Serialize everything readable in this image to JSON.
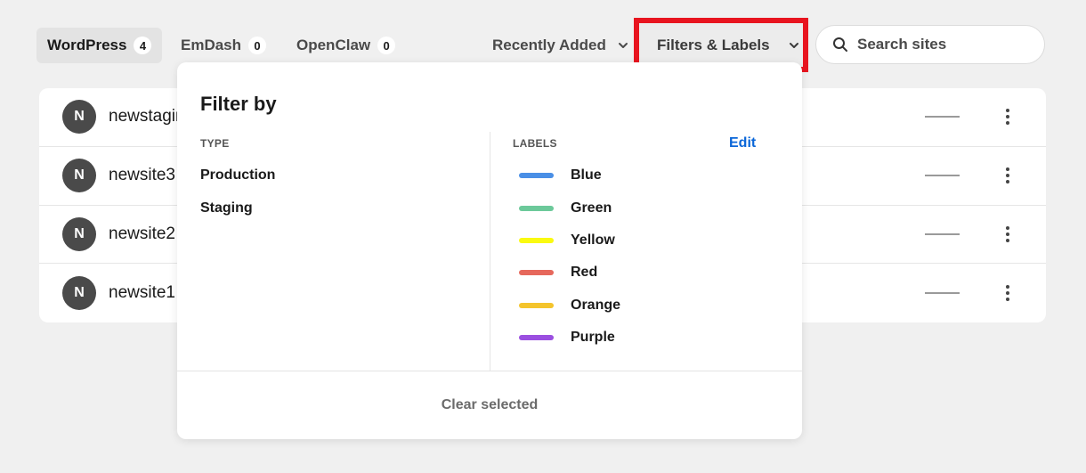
{
  "tabs": [
    {
      "label": "WordPress",
      "count": "4"
    },
    {
      "label": "EmDash",
      "count": "0"
    },
    {
      "label": "OpenClaw",
      "count": "0"
    }
  ],
  "sort": {
    "label": "Recently Added",
    "icon": "chevron-down-icon"
  },
  "filters": {
    "label": "Filters & Labels",
    "icon": "chevron-down-icon",
    "highlight_color": "#e8141f"
  },
  "search": {
    "placeholder": "Search sites",
    "icon": "search-icon"
  },
  "sites": [
    {
      "initial": "N",
      "name": "newstaging"
    },
    {
      "initial": "N",
      "name": "newsite3"
    },
    {
      "initial": "N",
      "name": "newsite2"
    },
    {
      "initial": "N",
      "name": "newsite1"
    }
  ],
  "dropdown": {
    "title": "Filter by",
    "type_header": "TYPE",
    "types": [
      "Production",
      "Staging"
    ],
    "labels_header": "LABELS",
    "edit_label": "Edit",
    "labels": [
      {
        "name": "Blue",
        "color": "#4a8fe6"
      },
      {
        "name": "Green",
        "color": "#6cc99a"
      },
      {
        "name": "Yellow",
        "color": "#fafa10"
      },
      {
        "name": "Red",
        "color": "#e6685c"
      },
      {
        "name": "Orange",
        "color": "#f4c42c"
      },
      {
        "name": "Purple",
        "color": "#9b4fe0"
      }
    ],
    "clear_label": "Clear selected"
  },
  "colors": {
    "accent": "#0a66d8",
    "avatar": "#4a4a4a"
  }
}
